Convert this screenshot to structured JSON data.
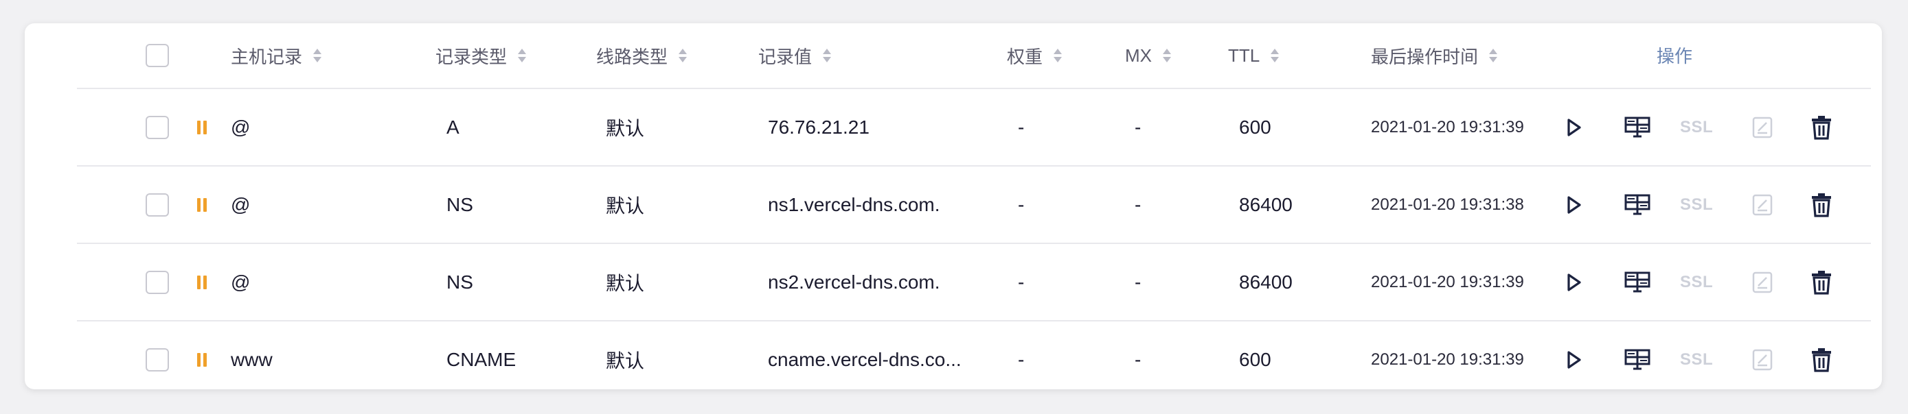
{
  "columns": {
    "host": "主机记录",
    "type": "记录类型",
    "line": "线路类型",
    "value": "记录值",
    "weight": "权重",
    "mx": "MX",
    "ttl": "TTL",
    "time": "最后操作时间",
    "ops": "操作"
  },
  "actions": {
    "ssl_label": "SSL"
  },
  "rows": [
    {
      "host": "@",
      "type": "A",
      "line": "默认",
      "value": "76.76.21.21",
      "weight": "-",
      "mx": "-",
      "ttl": "600",
      "time": "2021-01-20 19:31:39",
      "status": "paused"
    },
    {
      "host": "@",
      "type": "NS",
      "line": "默认",
      "value": "ns1.vercel-dns.com.",
      "weight": "-",
      "mx": "-",
      "ttl": "86400",
      "time": "2021-01-20 19:31:38",
      "status": "paused"
    },
    {
      "host": "@",
      "type": "NS",
      "line": "默认",
      "value": "ns2.vercel-dns.com.",
      "weight": "-",
      "mx": "-",
      "ttl": "86400",
      "time": "2021-01-20 19:31:39",
      "status": "paused"
    },
    {
      "host": "www",
      "type": "CNAME",
      "line": "默认",
      "value": "cname.vercel-dns.co...",
      "weight": "-",
      "mx": "-",
      "ttl": "600",
      "time": "2021-01-20 19:31:39",
      "status": "paused"
    }
  ],
  "colors": {
    "pause_accent": "#f0a02a",
    "ops_header": "#6b86b4",
    "icon_dark": "#1c2340",
    "icon_disabled": "#cdd0d9"
  },
  "icons": {
    "status": "pause-icon",
    "enable": "play-icon",
    "monitor": "monitor-icon",
    "ssl": "ssl-icon",
    "edit": "edit-icon",
    "delete": "trash-icon"
  }
}
